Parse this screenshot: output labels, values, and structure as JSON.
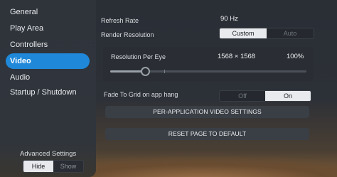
{
  "sidebar": {
    "items": [
      {
        "label": "General"
      },
      {
        "label": "Play Area"
      },
      {
        "label": "Controllers"
      },
      {
        "label": "Video",
        "active": true
      },
      {
        "label": "Audio"
      },
      {
        "label": "Startup / Shutdown"
      }
    ],
    "advanced_settings": {
      "label": "Advanced Settings",
      "hide_label": "Hide",
      "show_label": "Show",
      "selected": "Hide"
    }
  },
  "video": {
    "refresh_rate": {
      "label": "Refresh Rate",
      "value": "90 Hz"
    },
    "render_resolution": {
      "label": "Render Resolution",
      "options": [
        "Custom",
        "Auto"
      ],
      "selected": "Custom"
    },
    "resolution_per_eye": {
      "label": "Resolution Per Eye",
      "dimensions": "1568 × 1568",
      "percent": "100%",
      "slider_fraction": 0.18
    },
    "fade_to_grid": {
      "label": "Fade To Grid on app hang",
      "options": [
        "Off",
        "On"
      ],
      "selected": "On"
    },
    "per_application_button": "PER-APPLICATION VIDEO SETTINGS",
    "reset_button": "RESET PAGE TO DEFAULT"
  },
  "colors": {
    "accent": "#1f88d8",
    "panel_bg": "#2c3037",
    "toggle_on": "#e8eaed"
  }
}
